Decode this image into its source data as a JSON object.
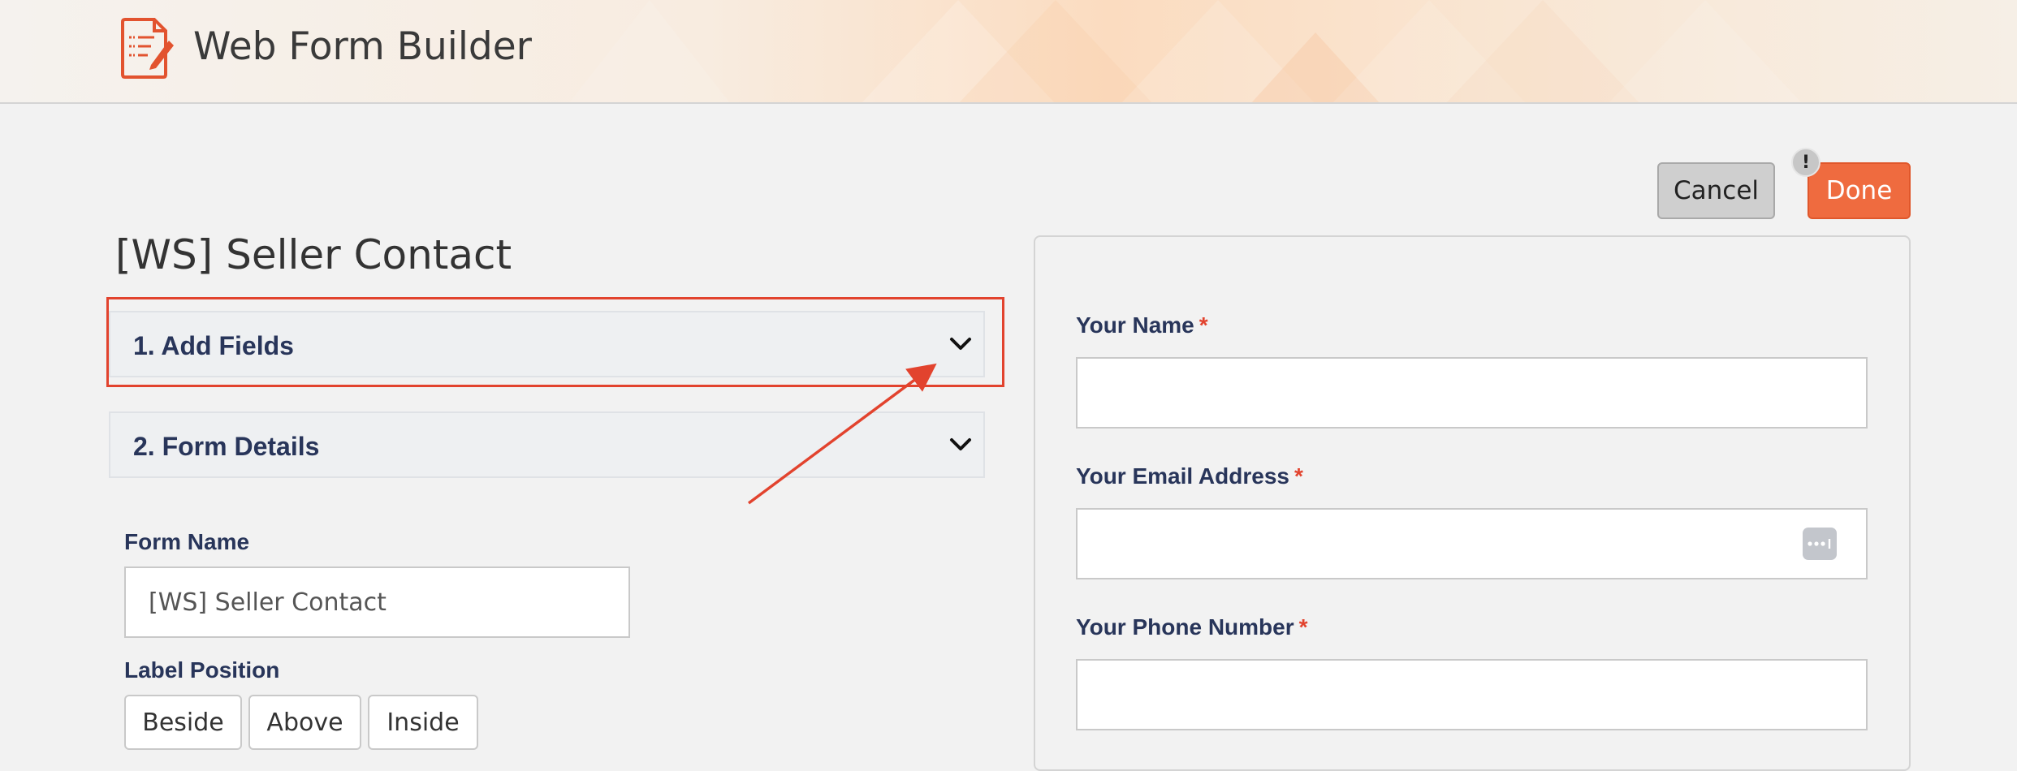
{
  "app": {
    "title": "Web Form Builder",
    "logo_icon": "form-edit-icon"
  },
  "actions": {
    "cancel_label": "Cancel",
    "done_label": "Done",
    "alert_badge": "!"
  },
  "form": {
    "title": "[WS] Seller Contact",
    "sections": [
      {
        "label": "1. Add Fields",
        "icon": "chevron-down-icon"
      },
      {
        "label": "2. Form Details",
        "icon": "chevron-down-icon"
      }
    ],
    "form_name_label": "Form Name",
    "form_name_value": "[WS] Seller Contact",
    "label_position_label": "Label Position",
    "label_position_options": [
      "Beside",
      "Above",
      "Inside"
    ]
  },
  "preview": {
    "fields": [
      {
        "label": "Your Name",
        "required_mark": "*"
      },
      {
        "label": "Your Email Address",
        "required_mark": "*"
      },
      {
        "label": "Your Phone Number",
        "required_mark": "*"
      }
    ]
  },
  "colors": {
    "accent": "#ef6b3f",
    "highlight": "#e2432e",
    "label_text": "#28355a"
  }
}
